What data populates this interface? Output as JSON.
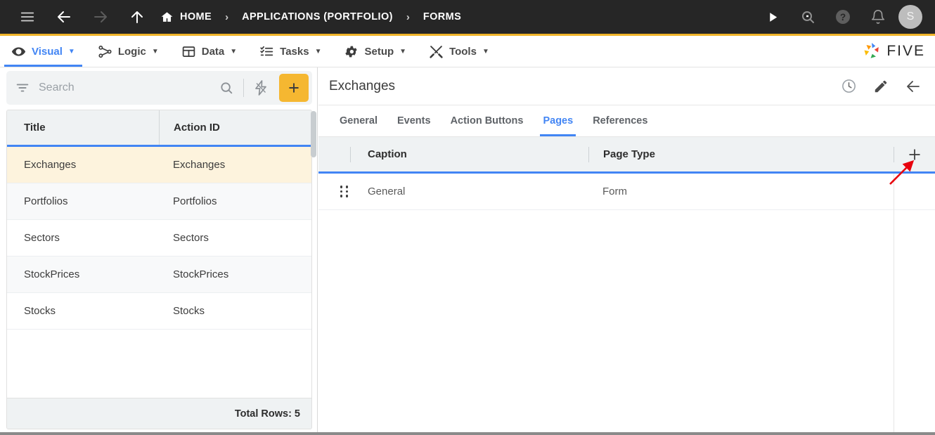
{
  "topbar": {
    "icons": [
      "hamburger-icon",
      "back-arrow-icon",
      "forward-arrow-icon",
      "up-arrow-icon"
    ],
    "breadcrumb": {
      "home": "HOME",
      "sep1": "›",
      "application": "APPLICATIONS (PORTFOLIO)",
      "sep2": "›",
      "current": "FORMS"
    },
    "right_icons": [
      "run-icon",
      "search-icon",
      "help-icon",
      "notifications-icon"
    ],
    "avatar_initial": "S",
    "accent_color": "#F0B429",
    "bg_color": "#262626"
  },
  "menubar": {
    "items": [
      {
        "label": "Visual",
        "icon": "eye-icon",
        "caret": "▼",
        "active": true
      },
      {
        "label": "Logic",
        "icon": "logic-icon",
        "caret": "▼",
        "active": false
      },
      {
        "label": "Data",
        "icon": "table-icon",
        "caret": "▼",
        "active": false
      },
      {
        "label": "Tasks",
        "icon": "checklist-icon",
        "caret": "▼",
        "active": false
      },
      {
        "label": "Setup",
        "icon": "gear-icon",
        "caret": "▼",
        "active": false
      },
      {
        "label": "Tools",
        "icon": "tools-icon",
        "caret": "▼",
        "active": false
      }
    ],
    "brand": "FIVE",
    "active_color": "#4285F4"
  },
  "left_panel": {
    "search": {
      "placeholder": "Search",
      "value": ""
    },
    "filter_icon": "filter-icon",
    "search_icon": "search-icon",
    "lightning_icon": "lightning-bolt-icon",
    "add_label": "+",
    "add_color": "#F5B731",
    "columns": [
      "Title",
      "Action ID"
    ],
    "rows": [
      {
        "title": "Exchanges",
        "action_id": "Exchanges",
        "selected": true
      },
      {
        "title": "Portfolios",
        "action_id": "Portfolios",
        "selected": false
      },
      {
        "title": "Sectors",
        "action_id": "Sectors",
        "selected": false
      },
      {
        "title": "StockPrices",
        "action_id": "StockPrices",
        "selected": false
      },
      {
        "title": "Stocks",
        "action_id": "Stocks",
        "selected": false
      }
    ],
    "footer": "Total Rows: 5",
    "selected_row_color": "#FDF3DD"
  },
  "right_panel": {
    "title": "Exchanges",
    "header_icons": [
      "history-clock-icon",
      "edit-pencil-icon",
      "back-arrow-icon"
    ],
    "tabs": [
      {
        "label": "General",
        "active": false
      },
      {
        "label": "Events",
        "active": false
      },
      {
        "label": "Action Buttons",
        "active": false
      },
      {
        "label": "Pages",
        "active": true
      },
      {
        "label": "References",
        "active": false
      }
    ],
    "pages_grid": {
      "columns": [
        "Caption",
        "Page Type"
      ],
      "add_label": "+",
      "rows": [
        {
          "drag": "drag-handle-icon",
          "caption": "General",
          "page_type": "Form"
        }
      ]
    }
  },
  "annotation": {
    "arrow_color": "#E8000D",
    "points_to": "add-page-button"
  }
}
